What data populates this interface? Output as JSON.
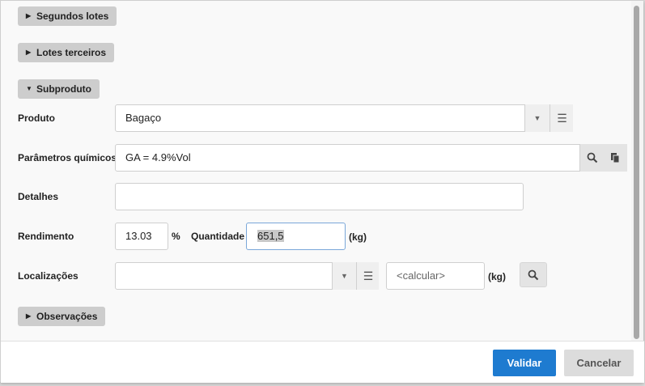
{
  "sections": {
    "segundos_lotes": "Segundos lotes",
    "lotes_terceiros": "Lotes terceiros",
    "subproduto": "Subproduto",
    "observacoes": "Observações"
  },
  "form": {
    "produto_label": "Produto",
    "produto_value": "Bagaço",
    "parametros_label": "Parâmetros químicos",
    "parametros_value": "GA = 4.9%Vol",
    "detalhes_label": "Detalhes",
    "detalhes_value": "",
    "rendimento_label": "Rendimento",
    "rendimento_value": "13.03",
    "rendimento_unit": "%",
    "quantidade_label": "Quantidade",
    "quantidade_value": "651,5",
    "quantidade_unit": "(kg)",
    "localizacoes_label": "Localizações",
    "localizacoes_value": "",
    "calcular_placeholder": "<calcular>",
    "calcular_unit": "(kg)"
  },
  "footer": {
    "validar": "Validar",
    "cancelar": "Cancelar"
  },
  "icons": {
    "expand_collapsed": "triangle-right",
    "expand_open": "triangle-down",
    "dropdown": "caret-down",
    "list": "hamburger",
    "search": "magnifier",
    "copy": "copy"
  },
  "colors": {
    "primary": "#1e7bd0",
    "section_bg": "#cdcdcd",
    "focus_border": "#7aa7d9"
  }
}
